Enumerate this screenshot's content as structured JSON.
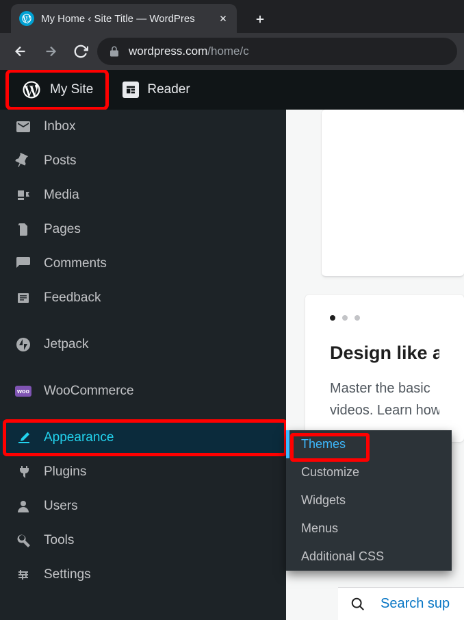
{
  "browser": {
    "tab_title": "My Home ‹ Site Title — WordPres",
    "url_host": "wordpress.com",
    "url_path": "/home/c"
  },
  "topbar": {
    "my_site": "My Site",
    "reader": "Reader"
  },
  "sidebar": {
    "items": [
      {
        "icon": "inbox-icon",
        "label": "Inbox"
      },
      {
        "icon": "pushpin-icon",
        "label": "Posts"
      },
      {
        "icon": "media-icon",
        "label": "Media"
      },
      {
        "icon": "pages-icon",
        "label": "Pages"
      },
      {
        "icon": "comments-icon",
        "label": "Comments"
      },
      {
        "icon": "feedback-icon",
        "label": "Feedback"
      },
      {
        "icon": "jetpack-icon",
        "label": "Jetpack"
      },
      {
        "icon": "woocommerce-icon",
        "label": "WooCommerce"
      },
      {
        "icon": "appearance-icon",
        "label": "Appearance",
        "active": true
      },
      {
        "icon": "plugins-icon",
        "label": "Plugins"
      },
      {
        "icon": "users-icon",
        "label": "Users"
      },
      {
        "icon": "tools-icon",
        "label": "Tools"
      },
      {
        "icon": "settings-icon",
        "label": "Settings"
      }
    ]
  },
  "submenu": {
    "items": [
      {
        "label": "Themes",
        "active": true
      },
      {
        "label": "Customize"
      },
      {
        "label": "Widgets"
      },
      {
        "label": "Menus"
      },
      {
        "label": "Additional CSS"
      }
    ]
  },
  "content": {
    "heading": "Design like an e",
    "body_l1": "Master the basic",
    "body_l2": "videos. Learn how",
    "search_label": "Search sup"
  },
  "icons": {
    "woo_text": "woo"
  }
}
